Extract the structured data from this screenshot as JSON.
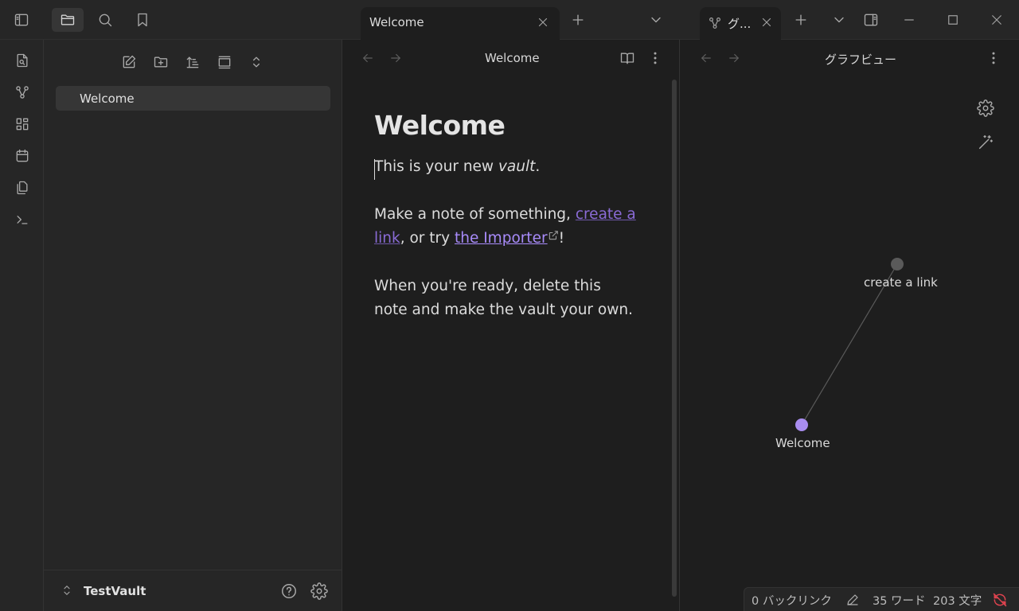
{
  "tabs": [
    {
      "label": "Welcome"
    },
    {
      "label": "グ..."
    }
  ],
  "explorer": {
    "files": [
      {
        "label": "Welcome"
      }
    ],
    "vault_name": "TestVault"
  },
  "editor": {
    "view_title": "Welcome",
    "heading": "Welcome",
    "p1_prefix": "This is your new ",
    "p1_em": "vault",
    "p1_suffix": ".",
    "p2_prefix": "Make a note of something, ",
    "p2_link1": "create a link",
    "p2_mid": ", or try ",
    "p2_link2": "the Importer",
    "p2_suffix": "!",
    "p3": "When you're ready, delete this note and make the vault your own."
  },
  "graph": {
    "view_title": "グラフビュー",
    "nodes": [
      {
        "label": "create a link",
        "color": "#5a5a5a"
      },
      {
        "label": "Welcome",
        "color": "#a98df0"
      }
    ]
  },
  "status": {
    "backlinks": "0 バックリンク",
    "words": "35 ワード",
    "chars": "203 文字"
  },
  "colors": {
    "accent": "#a98df0",
    "sync_error": "#e0434f"
  }
}
